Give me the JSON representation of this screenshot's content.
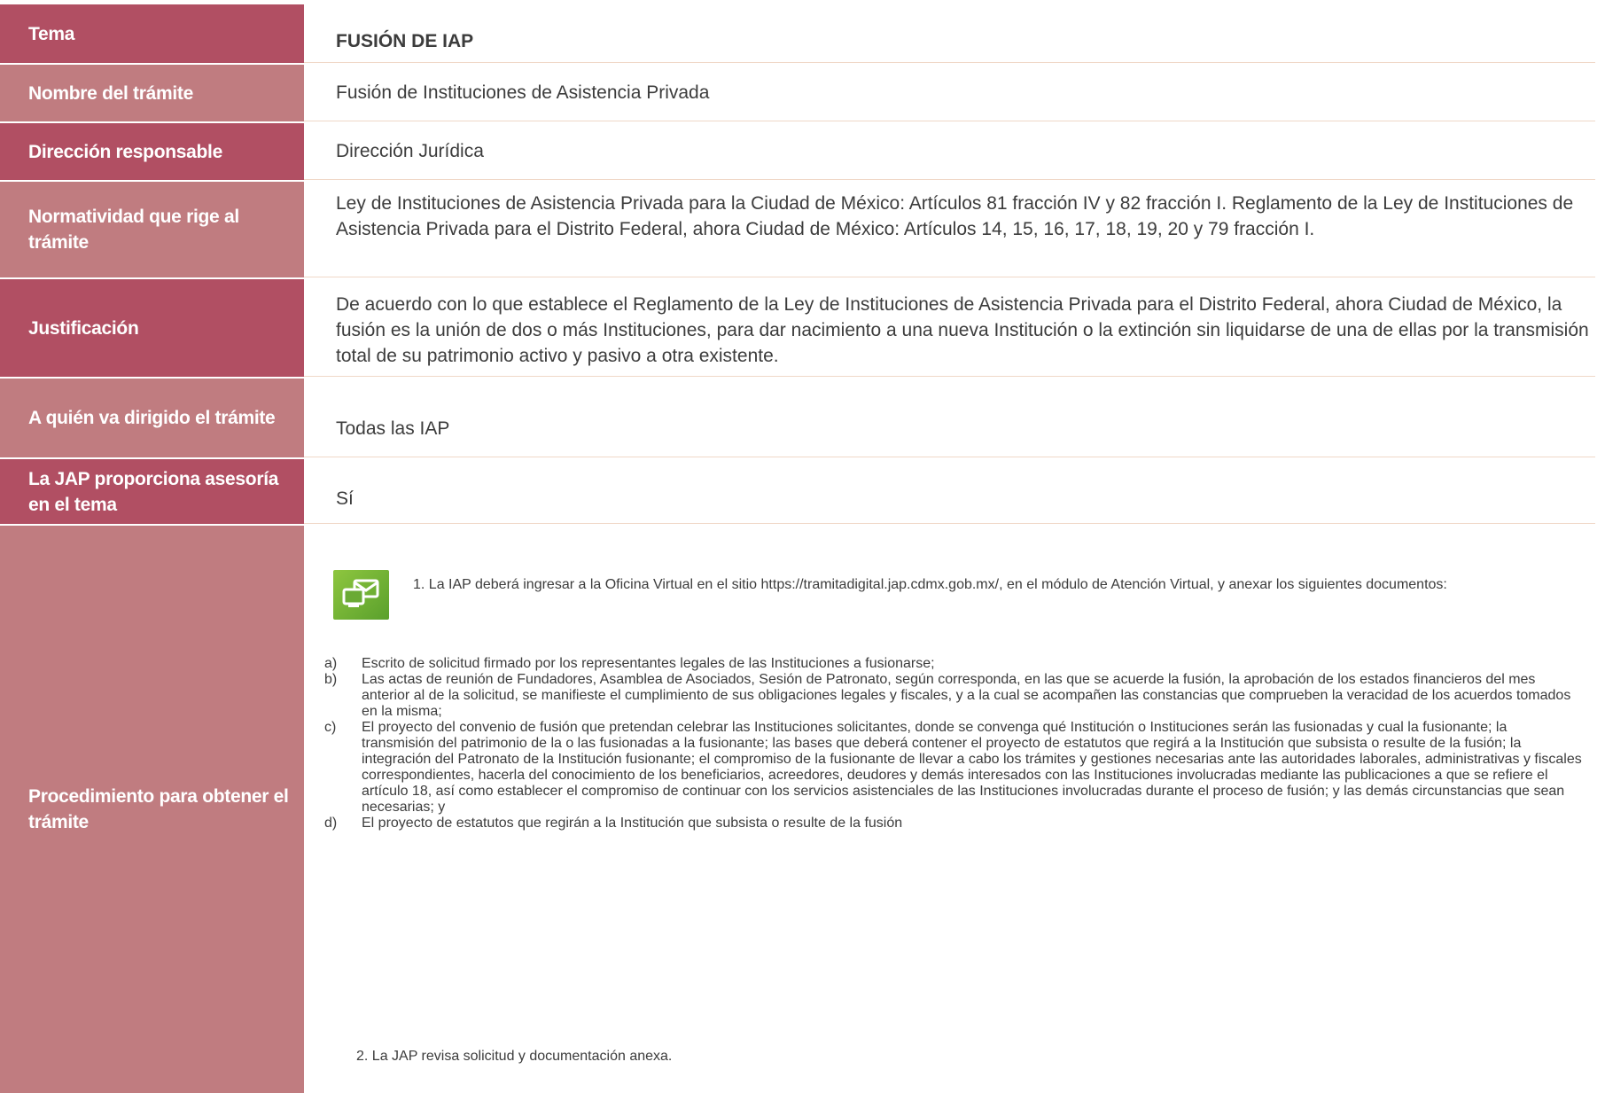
{
  "rows": {
    "tema": {
      "label": "Tema",
      "value": "FUSIÓN DE IAP"
    },
    "nombre": {
      "label": "Nombre del trámite",
      "value": "Fusión de Instituciones de Asistencia Privada"
    },
    "direccion": {
      "label": "Dirección responsable",
      "value": "Dirección Jurídica"
    },
    "normatividad": {
      "label_line1": "Normatividad que rige al",
      "label_line2": "trámite",
      "value": "Ley de Instituciones de Asistencia Privada para la Ciudad de México: Artículos 81 fracción IV y 82 fracción I. Reglamento de la Ley de Instituciones de Asistencia Privada para el Distrito Federal, ahora Ciudad de México: Artículos 14, 15, 16, 17, 18, 19, 20 y 79 fracción I."
    },
    "justificacion": {
      "label": "Justificación",
      "value": "De acuerdo con lo que establece el Reglamento de la Ley de Instituciones de Asistencia Privada para el Distrito Federal, ahora Ciudad de México, la fusión es la unión de dos o más Instituciones, para dar nacimiento a una nueva Institución o la extinción sin liquidarse de una de ellas por la transmisión total de su patrimonio activo y pasivo a otra existente."
    },
    "dirigido": {
      "label": "A quién va dirigido el trámite",
      "value": "Todas las IAP"
    },
    "asesoria": {
      "label_line1": "La JAP proporciona asesoría",
      "label_line2": "en el tema",
      "value": "Sí"
    },
    "procedimiento": {
      "label_line1": "Procedimiento para obtener el",
      "label_line2": "trámite",
      "intro": "1. La IAP deberá ingresar a la Oficina Virtual en el sitio https://tramitadigital.jap.cdmx.gob.mx/, en el módulo de Atención Virtual, y anexar los siguientes documentos:",
      "items": [
        {
          "marker": "a)",
          "text": "Escrito de solicitud firmado por los representantes legales de las Instituciones a fusionarse;"
        },
        {
          "marker": "b)",
          "text": "Las actas de reunión de Fundadores, Asamblea de Asociados, Sesión de Patronato, según corresponda, en las que se acuerde la fusión, la aprobación de los estados financieros del mes anterior al de la solicitud, se manifieste el cumplimiento de sus obligaciones legales y fiscales, y a la cual se acompañen las constancias que comprueben la veracidad de los acuerdos tomados en la misma;"
        },
        {
          "marker": "c)",
          "text": "El proyecto del convenio de fusión que pretendan celebrar las Instituciones solicitantes, donde se convenga qué Institución o Instituciones serán las fusionadas y cual la fusionante; la transmisión del patrimonio de la o las fusionadas a la fusionante; las bases que deberá contener el proyecto de estatutos que regirá a la Institución que subsista o resulte de la fusión; la integración del Patronato de la Institución fusionante; el compromiso de la fusionante de llevar a cabo los trámites y gestiones necesarias ante las autoridades laborales, administrativas y fiscales correspondientes, hacerla del conocimiento de los beneficiarios, acreedores, deudores y demás interesados con las Instituciones involucradas mediante las publicaciones a que se refiere el artículo 18, así como establecer el compromiso de continuar con los servicios asistenciales de las Instituciones involucradas durante el proceso de fusión; y las demás circunstancias que sean necesarias; y"
        },
        {
          "marker": "d)",
          "text": "El proyecto de estatutos que regirán a la Institución que subsista o resulte de la fusión"
        }
      ],
      "step2": "2. La JAP revisa solicitud y documentación anexa."
    }
  },
  "icons": {
    "office": "virtual-office-icon"
  },
  "colors": {
    "label_dark": "#b14f63",
    "label_mid": "#c07c80",
    "icon_green": "#6aaa35"
  }
}
